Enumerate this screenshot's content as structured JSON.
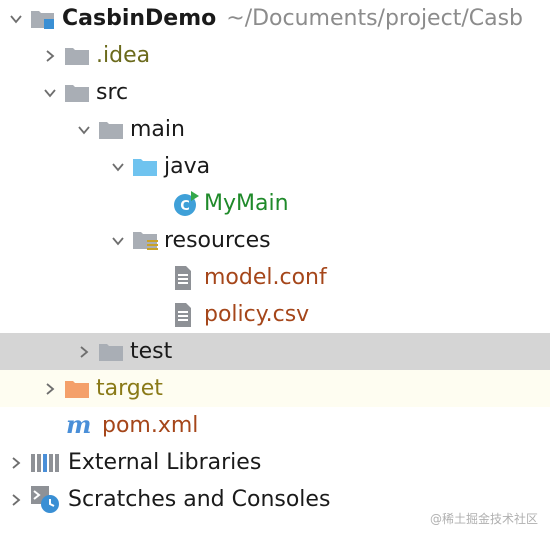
{
  "project": {
    "name": "CasbinDemo",
    "path": "~/Documents/project/Casb"
  },
  "tree": {
    "idea": ".idea",
    "src": "src",
    "main": "main",
    "java": "java",
    "mymain": "MyMain",
    "resources": "resources",
    "model_conf": "model.conf",
    "policy_csv": "policy.csv",
    "test": "test",
    "target": "target",
    "pom_xml": "pom.xml",
    "external_libraries": "External Libraries",
    "scratches": "Scratches and Consoles"
  },
  "watermark": "@稀土掘金技术社区",
  "colors": {
    "selected_row": "#d5d5d5",
    "excluded_row": "#fefdf1",
    "source_folder": "#6fc3ef",
    "excluded_folder": "#f4a06a",
    "plain_folder": "#a9aeb5",
    "class_icon": "#3fa0d8",
    "maven_icon": "#4a8fd8"
  },
  "icons": {
    "project": "module-folder-icon",
    "idea": "folder-icon",
    "src": "folder-icon",
    "main": "folder-icon",
    "java": "source-folder-icon",
    "mymain": "java-class-icon",
    "resources": "resources-folder-icon",
    "model_conf": "text-file-icon",
    "policy_csv": "text-file-icon",
    "test": "folder-icon",
    "target": "excluded-folder-icon",
    "pom_xml": "maven-icon",
    "external_libraries": "libraries-icon",
    "scratches": "scratches-icon"
  }
}
